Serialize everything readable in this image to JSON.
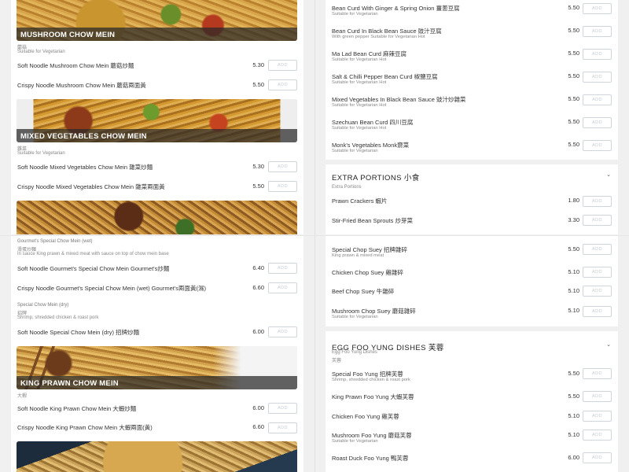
{
  "left_top": {
    "banner1": {
      "title": "MUSHROOM CHOW MEIN",
      "note1": "蘑菇",
      "note2": "Suitable for Vegetarian"
    },
    "items1": [
      {
        "name": "Soft Noodle Mushroom Chow Mein 蘑菇炒麵",
        "price": "5.30",
        "add": "ADD"
      },
      {
        "name": "Crispy Noodle Mushroom Chow Mein 蘑菇兩面黃",
        "price": "5.50",
        "add": "ADD"
      }
    ],
    "banner2": {
      "title": "MIXED VEGETABLES CHOW MEIN",
      "note1": "雜菜",
      "note2": "Suitable for Vegetarian"
    },
    "items2": [
      {
        "name": "Soft Noodle Mixed Vegetables Chow Mein 雜菜炒麵",
        "price": "5.30",
        "add": "ADD"
      },
      {
        "name": "Crispy Noodle Mixed Vegetables Chow Mein 雜菜兩面黃",
        "price": "5.50",
        "add": "ADD"
      }
    ]
  },
  "left_bot": {
    "gourmet_title": "Gourmet's Special Chow Mein (wet)",
    "gourmet_cn": "滑蛋炒麵",
    "gourmet_desc": "In sauce King prawn & mixed meat with sauce on top of chow mein base",
    "items1": [
      {
        "name": "Soft Noodle Gourmet's Special Chow Mein Gourmet's炒麵",
        "price": "6.40",
        "add": "ADD"
      },
      {
        "name": "Crispy Noodle Gourmet's Special Chow Mein (wet) Gourmet's兩面黃(濕)",
        "price": "6.60",
        "add": "ADD"
      }
    ],
    "special_title": "Special Chow Mein (dry)",
    "special_cn": "招牌",
    "special_desc": "Shrimp, shredded chicken & roast pork",
    "items2": [
      {
        "name": "Soft Noodle Special Chow Mein (dry) 招牌炒麵",
        "price": "6.00",
        "add": "ADD"
      }
    ],
    "banner": {
      "title": "KING PRAWN CHOW MEIN",
      "note1": "大蝦"
    },
    "items3": [
      {
        "name": "Soft Noodle King Prawn Chow Mein 大蝦炒麵",
        "price": "6.00",
        "add": "ADD"
      },
      {
        "name": "Crispy Noodle King Prawn Chow Mein 大蝦兩面(黃)",
        "price": "6.60",
        "add": "ADD"
      }
    ]
  },
  "right_top": {
    "items": [
      {
        "name": "Bean Curd With Ginger & Spring Onion 薑蔥豆腐",
        "sub": "Suitable for Vegetarian",
        "price": "5.50",
        "add": "ADD"
      },
      {
        "name": "Bean Curd In Black Bean Sauce 豉汁豆腐",
        "sub": "With green pepper Suitable for Vegetarian Hot",
        "price": "5.50",
        "add": "ADD"
      },
      {
        "name": "Ma Lad Bean Curd 麻辣豆腐",
        "sub": "Suitable for Vegetarian Hot",
        "price": "5.50",
        "add": "ADD"
      },
      {
        "name": "Salt & Chilli Pepper Bean Curd 椒鹽豆腐",
        "sub": "Suitable for Vegetarian Hot",
        "price": "5.50",
        "add": "ADD"
      },
      {
        "name": "Mixed Vegetables In Black Bean Sauce 豉汁炒雜菜",
        "sub": "Suitable for Vegetarian Hot",
        "price": "5.50",
        "add": "ADD"
      },
      {
        "name": "Szechuan Bean Curd 四川豆腐",
        "sub": "Suitable for Vegetarian Hot",
        "price": "5.50",
        "add": "ADD"
      },
      {
        "name": "Monk's Vegetables Monk齋菜",
        "sub": "Suitable for Vegetarian",
        "price": "5.50",
        "add": "ADD"
      }
    ],
    "section": {
      "title": "EXTRA PORTIONS 小食",
      "subtitle": "Extra Portions"
    },
    "extras": [
      {
        "name": "Prawn Crackers 蝦片",
        "price": "1.80",
        "add": "ADD"
      },
      {
        "name": "Stir-Fried Bean Sprouts 炒芽菜",
        "price": "3.30",
        "add": "ADD"
      }
    ]
  },
  "right_bot": {
    "items": [
      {
        "name": "Special Chop Suey 招牌雜碎",
        "sub": "King prawn & mixed meat",
        "price": "5.50",
        "add": "ADD"
      },
      {
        "name": "Chicken Chop Suey 雞雜碎",
        "sub": "",
        "price": "5.10",
        "add": "ADD"
      },
      {
        "name": "Beef Chop Suey 牛雜碎",
        "sub": "",
        "price": "5.10",
        "add": "ADD"
      },
      {
        "name": "Mushroom Chop Suey 蘑菇雜碎",
        "sub": "Suitable for Vegetarian",
        "price": "5.10",
        "add": "ADD"
      }
    ],
    "section": {
      "title": "EGG FOO YUNG DISHES 芙蓉",
      "subtitle": "Egg Foo Yung Dishes",
      "cn": "芙蓉"
    },
    "eggs": [
      {
        "name": "Special Foo Yung 招牌芙蓉",
        "sub": "Shrimp, shredded chicken & roast pork",
        "price": "5.50",
        "add": "ADD"
      },
      {
        "name": "King Prawn Foo Yung 大蝦芙蓉",
        "sub": "",
        "price": "5.50",
        "add": "ADD"
      },
      {
        "name": "Chicken Foo Yung 雞芙蓉",
        "sub": "",
        "price": "5.10",
        "add": "ADD"
      },
      {
        "name": "Mushroom Foo Yung 蘑菇芙蓉",
        "sub": "Suitable for Vegetarian",
        "price": "5.10",
        "add": "ADD"
      },
      {
        "name": "Roast Duck Foo Yung 鴨芙蓉",
        "sub": "",
        "price": "6.00",
        "add": "ADD"
      }
    ]
  }
}
